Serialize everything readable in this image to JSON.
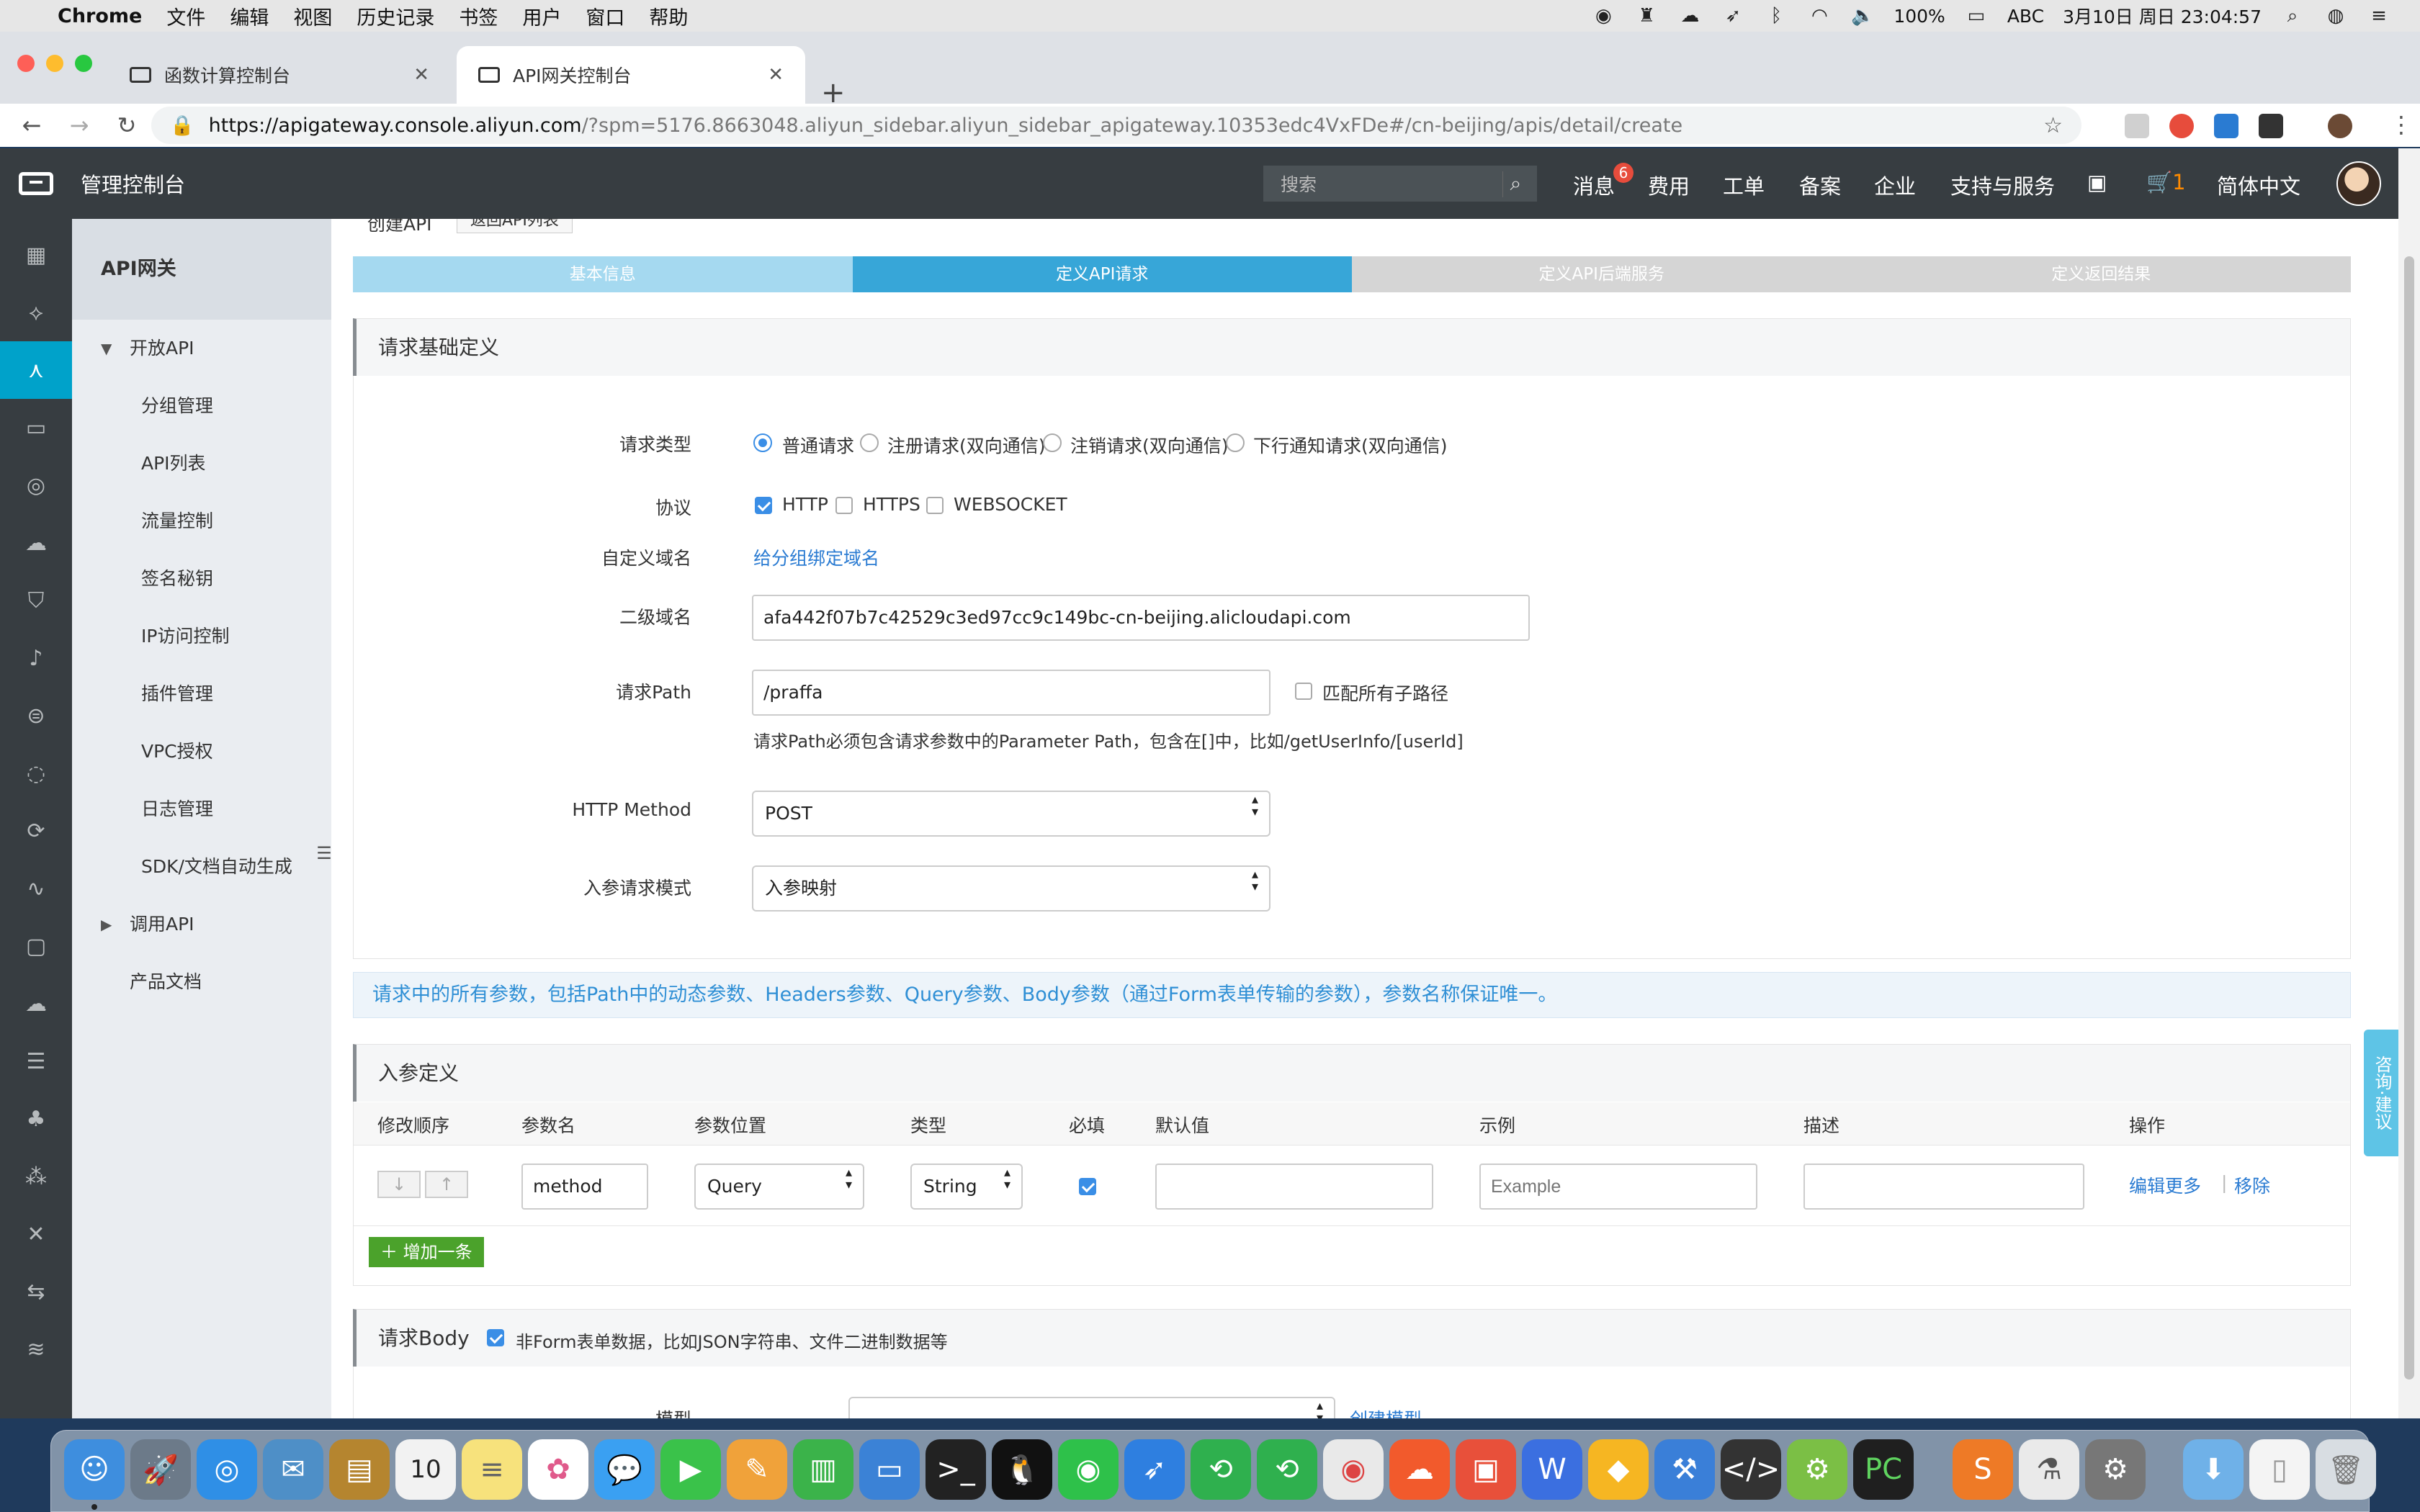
{
  "menubar": {
    "apple": "",
    "items": [
      "Chrome",
      "文件",
      "编辑",
      "视图",
      "历史记录",
      "书签",
      "用户",
      "窗口",
      "帮助"
    ],
    "battery": "100%",
    "input_method": "ABC",
    "datetime": "3月10日 周日 23:04:57"
  },
  "browser": {
    "tabs": [
      {
        "title": "函数计算控制台",
        "active": false
      },
      {
        "title": "API网关控制台",
        "active": true
      }
    ],
    "url_host": "https://apigateway.console.aliyun.com",
    "url_path": "/?spm=5176.8663048.aliyun_sidebar.aliyun_sidebar_apigateway.10353edc4VxFDe#/cn-beijing/apis/detail/create"
  },
  "header": {
    "title": "管理控制台",
    "search_placeholder": "搜索",
    "nav": [
      "消息",
      "费用",
      "工单",
      "备案",
      "企业",
      "支持与服务"
    ],
    "messages_badge": "6",
    "cart_count": "1",
    "language": "简体中文"
  },
  "sidebar": {
    "product": "API网关",
    "group_open": "开放API",
    "items": [
      "分组管理",
      "API列表",
      "流量控制",
      "签名秘钥",
      "IP访问控制",
      "插件管理",
      "VPC授权",
      "日志管理",
      "SDK/文档自动生成"
    ],
    "group_call": "调用API",
    "docs": "产品文档"
  },
  "page": {
    "crumb": "创建API",
    "back_label": "返回API列表",
    "steps": [
      "基本信息",
      "定义API请求",
      "定义API后端服务",
      "定义返回结果"
    ],
    "current_step": 1
  },
  "basic": {
    "title": "请求基础定义",
    "request_type_label": "请求类型",
    "request_types": [
      "普通请求",
      "注册请求(双向通信)",
      "注销请求(双向通信)",
      "下行通知请求(双向通信)"
    ],
    "request_type_selected": 0,
    "protocol_label": "协议",
    "protocols": [
      {
        "name": "HTTP",
        "checked": true
      },
      {
        "name": "HTTPS",
        "checked": false
      },
      {
        "name": "WEBSOCKET",
        "checked": false
      }
    ],
    "custom_domain_label": "自定义域名",
    "custom_domain_link": "给分组绑定域名",
    "subdomain_label": "二级域名",
    "subdomain_value": "afa442f07b7c42529c3ed97cc9c149bc-cn-beijing.alicloudapi.com",
    "path_label": "请求Path",
    "path_value": "/praffa",
    "match_subpath_label": "匹配所有子路径",
    "path_hint": "请求Path必须包含请求参数中的Parameter Path，包含在[]中，比如/getUserInfo/[userId]",
    "method_label": "HTTP Method",
    "method_value": "POST",
    "param_mode_label": "入参请求模式",
    "param_mode_value": "入参映射"
  },
  "notice": "请求中的所有参数，包括Path中的动态参数、Headers参数、Query参数、Body参数（通过Form表单传输的参数），参数名称保证唯一。",
  "params": {
    "title": "入参定义",
    "columns": [
      "修改顺序",
      "参数名",
      "参数位置",
      "类型",
      "必填",
      "默认值",
      "示例",
      "描述",
      "操作"
    ],
    "row": {
      "name": "method",
      "location": "Query",
      "type": "String",
      "required": true,
      "default": "",
      "example_placeholder": "Example",
      "description": "",
      "edit_more": "编辑更多",
      "remove": "移除"
    },
    "add_label": "增加一条"
  },
  "body": {
    "title": "请求Body",
    "nonform_label": "非Form表单数据，比如JSON字符串、文件二进制数据等",
    "nonform_checked": true,
    "model_label": "模型",
    "create_model_link": "创建模型"
  },
  "float_consult": "咨询·建议"
}
